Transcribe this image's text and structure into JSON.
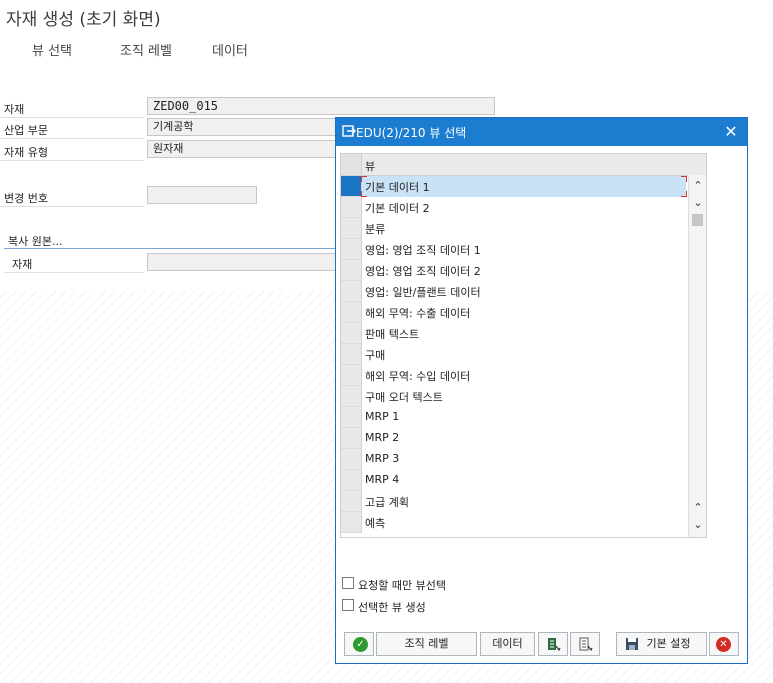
{
  "window": {
    "title": "자재 생성 (초기 화면)"
  },
  "menu": [
    {
      "label": "뷰 선택"
    },
    {
      "label": "조직 레벨"
    },
    {
      "label": "데이터"
    }
  ],
  "form": {
    "material_label": "자재",
    "material_value": "ZED00_015",
    "industry_label": "산업 부문",
    "industry_value": "기계공학",
    "mattype_label": "자재 유형",
    "mattype_value": "원자재",
    "change_label": "변경 번호",
    "change_value": "",
    "copy_section": "복사 원본...",
    "copy_material_label": "자재",
    "copy_material_value": ""
  },
  "dialog": {
    "title": "EDU(2)/210 뷰 선택",
    "column_header": "뷰",
    "rows": [
      {
        "label": "기본 데이터 1",
        "selected": true
      },
      {
        "label": "기본 데이터 2",
        "selected": false
      },
      {
        "label": "분류",
        "selected": false
      },
      {
        "label": "영업: 영업 조직 데이터 1",
        "selected": false
      },
      {
        "label": "영업: 영업 조직 데이터 2",
        "selected": false
      },
      {
        "label": "영업: 일반/플랜트 데이터",
        "selected": false
      },
      {
        "label": "해외 무역: 수출 데이터",
        "selected": false
      },
      {
        "label": "판매 텍스트",
        "selected": false
      },
      {
        "label": "구매",
        "selected": false
      },
      {
        "label": "해외 무역: 수입 데이터",
        "selected": false
      },
      {
        "label": "구매 오더 텍스트",
        "selected": false
      },
      {
        "label": "MRP 1",
        "selected": false
      },
      {
        "label": "MRP 2",
        "selected": false
      },
      {
        "label": "MRP 3",
        "selected": false
      },
      {
        "label": "MRP 4",
        "selected": false
      },
      {
        "label": "고급 계획",
        "selected": false
      },
      {
        "label": "예측",
        "selected": false
      }
    ],
    "checkbox_request_only": {
      "label": "요청할 때만 뷰선택",
      "checked": false
    },
    "checkbox_create_selected": {
      "label": "선택한 뷰 생성",
      "checked": false
    },
    "buttons": {
      "org_levels": "조직 레벨",
      "data": "데이터",
      "default": "기본 설정"
    },
    "icons": [
      "check-icon",
      "select-all-icon",
      "deselect-all-icon",
      "save-icon",
      "cancel-icon"
    ]
  },
  "colors": {
    "header_blue": "#1b7cd0",
    "selected_row": "#c9e2f5",
    "row_marker": "#1c75c2"
  }
}
